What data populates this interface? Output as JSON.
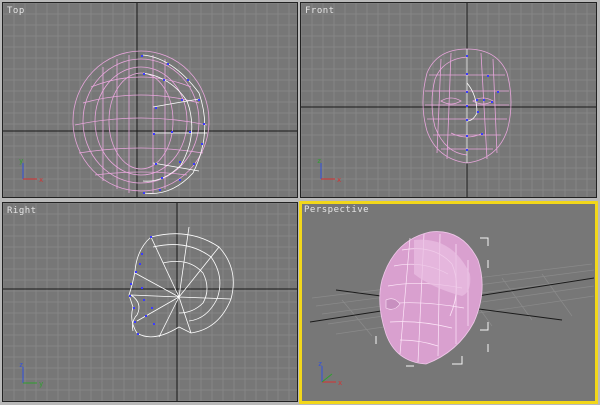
{
  "viewports": {
    "top": {
      "label": "Top"
    },
    "front": {
      "label": "Front"
    },
    "right": {
      "label": "Right"
    },
    "perspective": {
      "label": "Perspective"
    }
  },
  "active_viewport": "perspective",
  "colors": {
    "viewport_bg": "#777777",
    "grid_line": "#8a8a8a",
    "axis_line": "#1a1a1a",
    "wire_pink": "#e8a6dc",
    "wire_white": "#ffffff",
    "vertex_blue": "#3a3aff",
    "active_border": "#f2d71a",
    "axis_x": "#d83030",
    "axis_y": "#2ea02e",
    "axis_z": "#3050e0"
  },
  "axis_labels": {
    "x": "x",
    "y": "y",
    "z": "z"
  },
  "icons": [
    "axis-tripod-icon",
    "head-wireframe-mesh",
    "selection-bracket"
  ]
}
